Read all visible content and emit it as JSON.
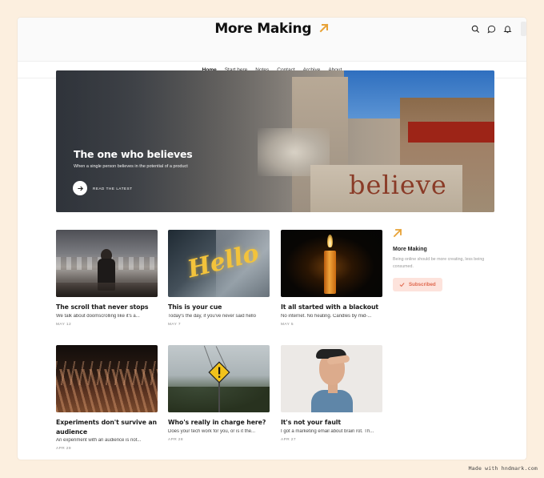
{
  "site": {
    "title": "More Making",
    "accent": "#e8a236"
  },
  "header_icons": [
    "search-icon",
    "chat-icon",
    "bell-icon"
  ],
  "nav": {
    "items": [
      {
        "label": "Home",
        "active": true
      },
      {
        "label": "Start here",
        "active": false
      },
      {
        "label": "Notes",
        "active": false
      },
      {
        "label": "Contact",
        "active": false
      },
      {
        "label": "Archive",
        "active": false
      },
      {
        "label": "About",
        "active": false
      }
    ]
  },
  "hero": {
    "title": "The one who believes",
    "subtitle": "When a single person believes in the potential of a product",
    "cta": "READ THE LATEST",
    "image_word": "believe"
  },
  "posts": [
    {
      "title": "The scroll that never stops",
      "excerpt": "We talk about doomscrolling like it's a...",
      "date": "MAY 12"
    },
    {
      "title": "This is your cue",
      "excerpt": "Today's the day, if you've never said hello",
      "date": "MAY 7",
      "image_word": "Hello"
    },
    {
      "title": "It all started with a blackout",
      "excerpt": "No internet. No heating. Candles by mid-...",
      "date": "MAY 5"
    },
    {
      "title": "Experiments don't survive an audience",
      "excerpt": "An experiment with an audience is not...",
      "date": "APR 29"
    },
    {
      "title": "Who's really in charge here?",
      "excerpt": "Does your tech work for you, or is it the...",
      "date": "APR 28"
    },
    {
      "title": "It's not your fault",
      "excerpt": "I got a marketing email about brain rot. Th...",
      "date": "APR 27"
    }
  ],
  "sidebar": {
    "name": "More Making",
    "description": "Being online should be more creating, less being consumed.",
    "button": "Subscribed",
    "button_color": "#e0694f"
  },
  "footer": {
    "note": "Made with hndmark.com"
  }
}
